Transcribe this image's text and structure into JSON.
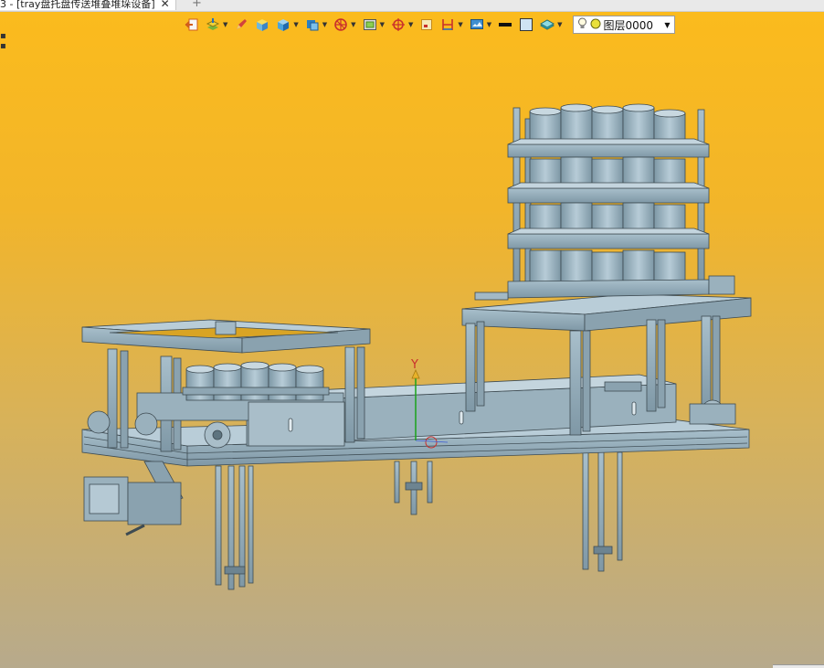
{
  "tab": {
    "title": "3 - [tray盘托盘传送堆叠堆垛设备]",
    "close_glyph": "✕",
    "new_tab_glyph": "+"
  },
  "toolbar": {
    "items": [
      {
        "icon": "exit-sketch-icon",
        "has_dropdown": false
      },
      {
        "icon": "layer-stack-icon",
        "has_dropdown": true
      },
      {
        "icon": "pen-edit-icon",
        "has_dropdown": false
      },
      {
        "icon": "shaded-cube-icon",
        "has_dropdown": false
      },
      {
        "icon": "solid-cube-icon",
        "has_dropdown": true
      },
      {
        "icon": "view-cube-icon",
        "has_dropdown": true
      },
      {
        "icon": "section-wheel-icon",
        "has_dropdown": true
      },
      {
        "icon": "frame-view-icon",
        "has_dropdown": true
      },
      {
        "icon": "target-crosshair-icon",
        "has_dropdown": true
      },
      {
        "icon": "fit-view-icon",
        "has_dropdown": false
      },
      {
        "icon": "dimension-icon",
        "has_dropdown": true
      },
      {
        "icon": "render-display-icon",
        "has_dropdown": true
      },
      {
        "icon": "line-color-icon",
        "has_dropdown": false
      },
      {
        "icon": "fill-color-icon",
        "has_dropdown": false
      },
      {
        "icon": "plane-layer-icon",
        "has_dropdown": true
      }
    ],
    "layer_select": {
      "value": "图层0000",
      "icons": [
        "lightbulb-icon",
        "layer-dot-icon"
      ]
    }
  },
  "viewport": {
    "axis_label": "Y",
    "colors": {
      "frame": "#8fa7b4",
      "frame_dark": "#4f5f68",
      "bg_top": "#fbbb1d",
      "bg_bottom": "#b7aa8c",
      "axis": "#1aa31a"
    }
  }
}
